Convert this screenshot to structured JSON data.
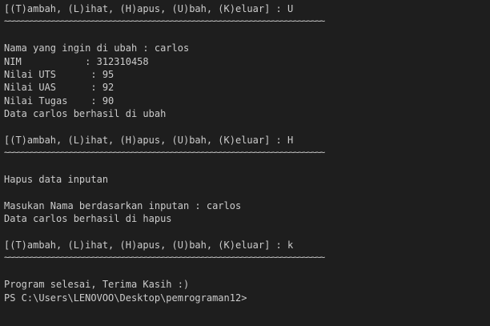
{
  "terminal": {
    "lines": [
      "[(T)ambah, (L)ihat, (H)apus, (U)bah, (K)eluar] : U",
      "~~~~~~~~~~~~~~~~~~~~~~~~~~~~~~~~~~~~~~~~~~~~~~~~~~~~~~~~~~~~~~~~~~~~~~~~~",
      "",
      "Nama yang ingin di ubah : carlos",
      "NIM           : 312310458",
      "Nilai UTS      : 95",
      "Nilai UAS      : 92",
      "Nilai Tugas    : 90",
      "Data carlos berhasil di ubah",
      "",
      "[(T)ambah, (L)ihat, (H)apus, (U)bah, (K)eluar] : H",
      "~~~~~~~~~~~~~~~~~~~~~~~~~~~~~~~~~~~~~~~~~~~~~~~~~~~~~~~~~~~~~~~~~~~~~~~~~",
      "",
      "Hapus data inputan",
      "",
      "Masukan Nama berdasarkan inputan : carlos",
      "Data carlos berhasil di hapus",
      "",
      "[(T)ambah, (L)ihat, (H)apus, (U)bah, (K)eluar] : k",
      "~~~~~~~~~~~~~~~~~~~~~~~~~~~~~~~~~~~~~~~~~~~~~~~~~~~~~~~~~~~~~~~~~~~~~~~~~",
      "",
      "Program selesai, Terima Kasih :)",
      "PS C:\\Users\\LENOVOO\\Desktop\\pemrograman12>"
    ]
  },
  "colors": {
    "background": "#1e1e1e",
    "text": "#cccccc"
  }
}
